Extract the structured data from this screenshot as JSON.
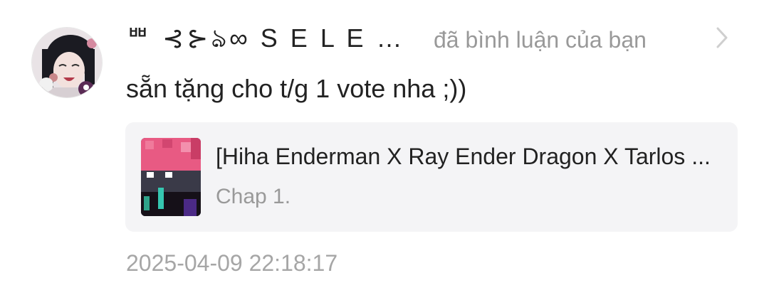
{
  "notification": {
    "username": "ᄈ ⊰⊱ঌ∞ S E L E N...",
    "action": "đã bình luận của bạn",
    "comment": "sẵn tặng cho t/g 1 vote nha ;))",
    "timestamp": "2025-04-09 22:18:17",
    "icons": {
      "chevron": "chevron-right-icon"
    },
    "story": {
      "title": "[Hiha Enderman X Ray Ender Dragon X Tarlos ...",
      "chapter": "Chap 1."
    }
  }
}
